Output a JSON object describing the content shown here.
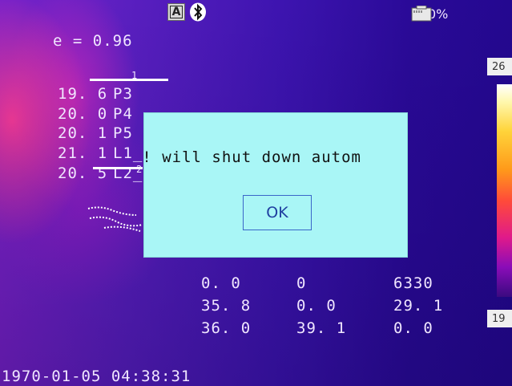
{
  "status_bar": {
    "mode_icon_letter": "A",
    "bluetooth_icon": "bluetooth-icon",
    "battery_icon": "battery-icon",
    "battery_percent": "0%"
  },
  "emissivity": "e = 0.96",
  "measurements": [
    {
      "value": "19. 6",
      "label": "P3"
    },
    {
      "value": "20. 0",
      "label": "P4"
    },
    {
      "value": "20. 1",
      "label": "P5"
    },
    {
      "value": "21. 1",
      "label": "L1_("
    },
    {
      "value": "20. 5",
      "label": "L2_("
    }
  ],
  "overlay_markers": {
    "p3_marker": "1",
    "l1_marker": "2"
  },
  "dialog": {
    "message": "low! will shut down autom",
    "ok_label": "OK"
  },
  "stats_table": [
    [
      "0. 0",
      "0",
      "6330"
    ],
    [
      "35. 8",
      "0. 0",
      "29. 1"
    ],
    [
      "36. 0",
      "39. 1",
      "0. 0"
    ]
  ],
  "color_scale": {
    "max": "26",
    "min": "19"
  },
  "timestamp": "1970-01-05 04:38:31"
}
